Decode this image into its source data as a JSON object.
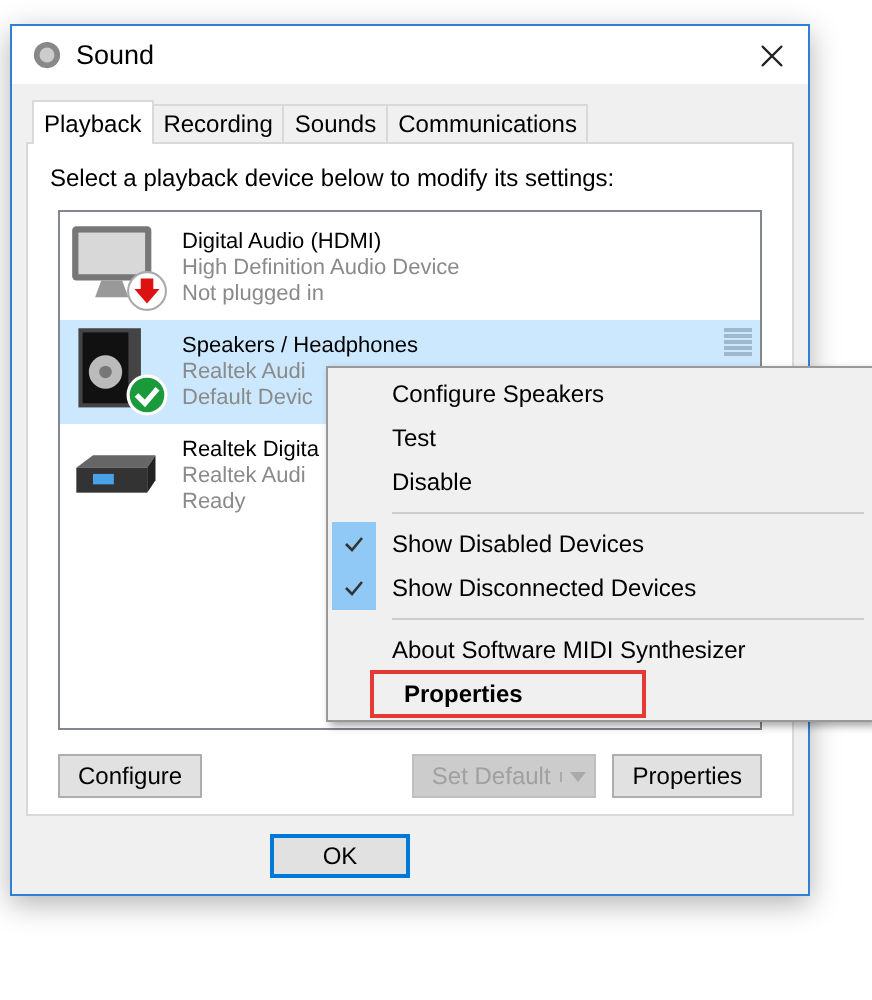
{
  "window": {
    "title": "Sound"
  },
  "tabs": [
    {
      "label": "Playback",
      "selected": true
    },
    {
      "label": "Recording",
      "selected": false
    },
    {
      "label": "Sounds",
      "selected": false
    },
    {
      "label": "Communications",
      "selected": false
    }
  ],
  "instruction": "Select a playback device below to modify its settings:",
  "devices": [
    {
      "kind": "monitor",
      "plugged_in": false,
      "default": false,
      "name": "Digital Audio (HDMI)",
      "driver": "High Definition Audio Device",
      "status": "Not plugged in",
      "selected": false
    },
    {
      "kind": "speaker",
      "plugged_in": true,
      "default": true,
      "name": "Speakers / Headphones",
      "driver": "Realtek Audi",
      "status": "Default Devic",
      "selected": true
    },
    {
      "kind": "receiver",
      "plugged_in": true,
      "default": false,
      "name": "Realtek Digita",
      "driver": "Realtek Audi",
      "status": "Ready",
      "selected": false
    }
  ],
  "context_menu": {
    "items": [
      {
        "kind": "item",
        "label": "Configure Speakers"
      },
      {
        "kind": "item",
        "label": "Test"
      },
      {
        "kind": "item",
        "label": "Disable"
      },
      {
        "kind": "separator"
      },
      {
        "kind": "check",
        "label": "Show Disabled Devices",
        "checked": true
      },
      {
        "kind": "check",
        "label": "Show Disconnected Devices",
        "checked": true
      },
      {
        "kind": "separator"
      },
      {
        "kind": "item",
        "label": "About Software MIDI Synthesizer"
      },
      {
        "kind": "default",
        "label": "Properties",
        "outlined": true
      }
    ]
  },
  "buttons": [
    {
      "kind": "plain",
      "label": "Configure",
      "disabled": false
    },
    {
      "kind": "split",
      "label": "Set Default",
      "disabled": true
    },
    {
      "kind": "plain",
      "label": "Properties",
      "disabled": false
    }
  ],
  "dialog_buttons": [
    {
      "label": "OK",
      "default": true
    }
  ]
}
